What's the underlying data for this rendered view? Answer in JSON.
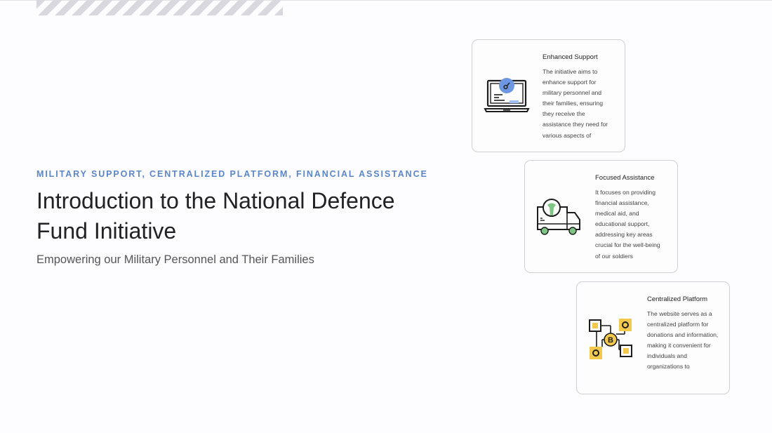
{
  "hero": {
    "tags": "MILITARY SUPPORT, CENTRALIZED PLATFORM, FINANCIAL ASSISTANCE",
    "title_line1": "Introduction to the National Defence",
    "title_line2": "Fund Initiative",
    "subtitle": "Empowering our Military Personnel and Their Families"
  },
  "cards": [
    {
      "title": "Enhanced Support",
      "text": "The initiative aims to enhance support for military personnel and their families, ensuring they receive the assistance they need for various aspects of",
      "icon": "laptop-gauge-icon"
    },
    {
      "title": "Focused Assistance",
      "text": "It focuses on providing financial assistance, medical aid, and educational support, addressing key areas crucial for the well-being of our soldiers",
      "icon": "truck-wrench-icon"
    },
    {
      "title": "Centralized Platform",
      "text": "The website serves as a centralized platform for donations and information, making it convenient for individuals and organizations to",
      "icon": "network-hub-icon",
      "icon_letter": "B"
    }
  ],
  "colors": {
    "accent": "#5b86c9",
    "icon_blue": "#6d96e3",
    "icon_green": "#7ec683",
    "icon_yellow": "#f2c94c"
  }
}
